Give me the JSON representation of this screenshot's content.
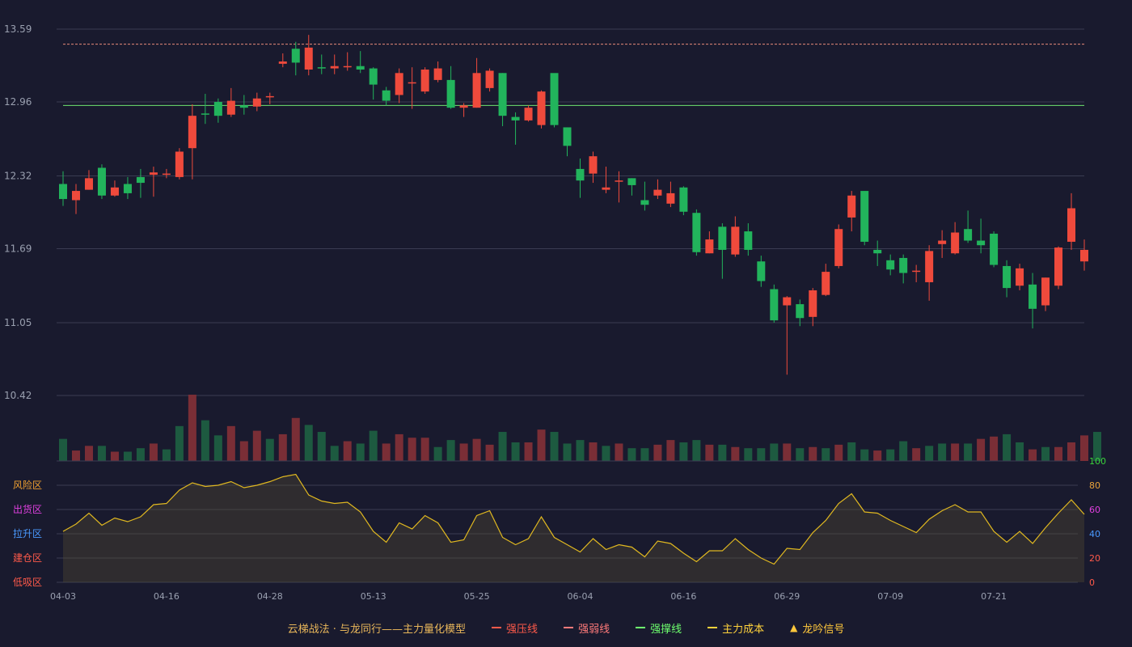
{
  "chart_data": {
    "type": "candlestick",
    "price_axis": {
      "ticks": [
        "13.59",
        "12.96",
        "12.32",
        "11.69",
        "11.05",
        "10.42"
      ],
      "min": 10.42,
      "max": 13.59
    },
    "x_tick_labels": [
      {
        "index": 0,
        "label": "04-03"
      },
      {
        "index": 8,
        "label": "04-16"
      },
      {
        "index": 16,
        "label": "04-28"
      },
      {
        "index": 24,
        "label": "05-13"
      },
      {
        "index": 32,
        "label": "05-25"
      },
      {
        "index": 40,
        "label": "06-04"
      },
      {
        "index": 48,
        "label": "06-16"
      },
      {
        "index": 56,
        "label": "06-29"
      },
      {
        "index": 64,
        "label": "07-09"
      },
      {
        "index": 72,
        "label": "07-21"
      }
    ],
    "candles": [
      [
        12.25,
        12.12,
        12.36,
        12.06
      ],
      [
        12.11,
        12.19,
        12.25,
        11.99
      ],
      [
        12.2,
        12.3,
        12.37,
        12.2
      ],
      [
        12.39,
        12.15,
        12.42,
        12.12
      ],
      [
        12.15,
        12.22,
        12.28,
        12.14
      ],
      [
        12.25,
        12.17,
        12.31,
        12.12
      ],
      [
        12.31,
        12.26,
        12.38,
        12.13
      ],
      [
        12.33,
        12.35,
        12.4,
        12.14
      ],
      [
        12.34,
        12.34,
        12.38,
        12.3
      ],
      [
        12.31,
        12.53,
        12.56,
        12.29
      ],
      [
        12.56,
        12.84,
        12.94,
        12.29
      ],
      [
        12.86,
        12.85,
        13.03,
        12.77
      ],
      [
        12.96,
        12.84,
        12.99,
        12.78
      ],
      [
        12.85,
        12.97,
        13.08,
        12.83
      ],
      [
        12.93,
        12.91,
        13.02,
        12.85
      ],
      [
        12.92,
        12.99,
        13.04,
        12.88
      ],
      [
        13.01,
        13.01,
        13.04,
        12.94
      ],
      [
        13.29,
        13.31,
        13.38,
        13.26
      ],
      [
        13.42,
        13.3,
        13.48,
        13.19
      ],
      [
        13.24,
        13.43,
        13.54,
        13.19
      ],
      [
        13.26,
        13.25,
        13.37,
        13.2
      ],
      [
        13.25,
        13.27,
        13.37,
        13.2
      ],
      [
        13.26,
        13.27,
        13.39,
        13.23
      ],
      [
        13.27,
        13.24,
        13.4,
        13.21
      ],
      [
        13.25,
        13.11,
        13.26,
        12.98
      ],
      [
        13.06,
        12.97,
        13.09,
        12.93
      ],
      [
        13.02,
        13.21,
        13.25,
        12.95
      ],
      [
        13.13,
        13.13,
        13.26,
        12.9
      ],
      [
        13.05,
        13.24,
        13.26,
        13.03
      ],
      [
        13.15,
        13.25,
        13.31,
        13.13
      ],
      [
        13.15,
        12.91,
        13.27,
        12.9
      ],
      [
        12.91,
        12.93,
        12.95,
        12.83
      ],
      [
        12.91,
        13.21,
        13.34,
        12.91
      ],
      [
        13.08,
        13.23,
        13.25,
        13.05
      ],
      [
        13.21,
        12.84,
        13.21,
        12.75
      ],
      [
        12.83,
        12.8,
        12.87,
        12.59
      ],
      [
        12.8,
        12.91,
        12.93,
        12.79
      ],
      [
        12.76,
        13.05,
        13.06,
        12.73
      ],
      [
        13.21,
        12.76,
        13.2,
        12.74
      ],
      [
        12.74,
        12.58,
        12.74,
        12.49
      ],
      [
        12.38,
        12.28,
        12.47,
        12.13
      ],
      [
        12.34,
        12.49,
        12.53,
        12.26
      ],
      [
        12.2,
        12.22,
        12.4,
        12.17
      ],
      [
        12.28,
        12.28,
        12.36,
        12.09
      ],
      [
        12.3,
        12.24,
        12.3,
        12.15
      ],
      [
        12.11,
        12.07,
        12.27,
        12.02
      ],
      [
        12.15,
        12.2,
        12.29,
        12.12
      ],
      [
        12.08,
        12.17,
        12.27,
        12.05
      ],
      [
        12.22,
        12.01,
        12.23,
        11.98
      ],
      [
        12.0,
        11.66,
        12.03,
        11.63
      ],
      [
        11.65,
        11.77,
        11.84,
        11.65
      ],
      [
        11.88,
        11.68,
        11.91,
        11.43
      ],
      [
        11.64,
        11.88,
        11.97,
        11.62
      ],
      [
        11.84,
        11.68,
        11.91,
        11.63
      ],
      [
        11.58,
        11.41,
        11.63,
        11.36
      ],
      [
        11.34,
        11.07,
        11.38,
        11.05
      ],
      [
        11.2,
        11.27,
        11.28,
        10.6
      ],
      [
        11.21,
        11.09,
        11.25,
        11.02
      ],
      [
        11.1,
        11.33,
        11.35,
        11.02
      ],
      [
        11.29,
        11.49,
        11.56,
        11.28
      ],
      [
        11.54,
        11.86,
        11.9,
        11.52
      ],
      [
        11.96,
        12.15,
        12.19,
        11.84
      ],
      [
        12.19,
        11.75,
        12.18,
        11.72
      ],
      [
        11.68,
        11.65,
        11.76,
        11.54
      ],
      [
        11.59,
        11.51,
        11.64,
        11.46
      ],
      [
        11.61,
        11.48,
        11.64,
        11.39
      ],
      [
        11.49,
        11.5,
        11.55,
        11.4
      ],
      [
        11.4,
        11.67,
        11.72,
        11.24
      ],
      [
        11.73,
        11.76,
        11.85,
        11.61
      ],
      [
        11.65,
        11.83,
        11.92,
        11.64
      ],
      [
        11.86,
        11.76,
        12.02,
        11.74
      ],
      [
        11.76,
        11.72,
        11.95,
        11.65
      ],
      [
        11.82,
        11.55,
        11.84,
        11.53
      ],
      [
        11.54,
        11.35,
        11.59,
        11.27
      ],
      [
        11.37,
        11.52,
        11.56,
        11.33
      ],
      [
        11.38,
        11.17,
        11.48,
        11.0
      ],
      [
        11.2,
        11.44,
        11.44,
        11.15
      ],
      [
        11.37,
        11.7,
        11.71,
        11.34
      ],
      [
        11.75,
        12.04,
        12.17,
        11.68
      ],
      [
        11.58,
        11.68,
        11.77,
        11.5
      ]
    ],
    "volume": [
      [
        1.9,
        "up"
      ],
      [
        0.9,
        "dn"
      ],
      [
        1.3,
        "dn"
      ],
      [
        1.3,
        "up"
      ],
      [
        0.8,
        "dn"
      ],
      [
        0.8,
        "up"
      ],
      [
        1.1,
        "up"
      ],
      [
        1.5,
        "dn"
      ],
      [
        1.0,
        "up"
      ],
      [
        3.0,
        "up"
      ],
      [
        5.7,
        "dn"
      ],
      [
        3.5,
        "up"
      ],
      [
        2.2,
        "up"
      ],
      [
        3.0,
        "dn"
      ],
      [
        1.7,
        "dn"
      ],
      [
        2.6,
        "dn"
      ],
      [
        1.9,
        "up"
      ],
      [
        2.3,
        "dn"
      ],
      [
        3.7,
        "dn"
      ],
      [
        3.1,
        "up"
      ],
      [
        2.5,
        "up"
      ],
      [
        1.3,
        "up"
      ],
      [
        1.7,
        "dn"
      ],
      [
        1.5,
        "up"
      ],
      [
        2.6,
        "up"
      ],
      [
        1.5,
        "dn"
      ],
      [
        2.3,
        "dn"
      ],
      [
        2.0,
        "dn"
      ],
      [
        2.0,
        "dn"
      ],
      [
        1.2,
        "up"
      ],
      [
        1.8,
        "up"
      ],
      [
        1.5,
        "dn"
      ],
      [
        1.9,
        "dn"
      ],
      [
        1.4,
        "dn"
      ],
      [
        2.5,
        "up"
      ],
      [
        1.6,
        "up"
      ],
      [
        1.6,
        "dn"
      ],
      [
        2.7,
        "dn"
      ],
      [
        2.5,
        "up"
      ],
      [
        1.5,
        "up"
      ],
      [
        1.8,
        "up"
      ],
      [
        1.6,
        "dn"
      ],
      [
        1.3,
        "up"
      ],
      [
        1.5,
        "dn"
      ],
      [
        1.1,
        "up"
      ],
      [
        1.1,
        "up"
      ],
      [
        1.4,
        "dn"
      ],
      [
        1.8,
        "dn"
      ],
      [
        1.6,
        "up"
      ],
      [
        1.8,
        "up"
      ],
      [
        1.4,
        "dn"
      ],
      [
        1.4,
        "up"
      ],
      [
        1.2,
        "dn"
      ],
      [
        1.1,
        "up"
      ],
      [
        1.1,
        "up"
      ],
      [
        1.5,
        "up"
      ],
      [
        1.5,
        "dn"
      ],
      [
        1.1,
        "up"
      ],
      [
        1.2,
        "dn"
      ],
      [
        1.1,
        "up"
      ],
      [
        1.4,
        "dn"
      ],
      [
        1.6,
        "up"
      ],
      [
        1.0,
        "up"
      ],
      [
        0.9,
        "dn"
      ],
      [
        1.0,
        "up"
      ],
      [
        1.7,
        "up"
      ],
      [
        1.1,
        "dn"
      ],
      [
        1.3,
        "up"
      ],
      [
        1.5,
        "up"
      ],
      [
        1.5,
        "dn"
      ],
      [
        1.5,
        "up"
      ],
      [
        1.9,
        "dn"
      ],
      [
        2.1,
        "dn"
      ],
      [
        2.3,
        "up"
      ],
      [
        1.6,
        "up"
      ],
      [
        1.0,
        "dn"
      ],
      [
        1.2,
        "up"
      ],
      [
        1.2,
        "dn"
      ],
      [
        1.6,
        "dn"
      ],
      [
        2.2,
        "dn"
      ],
      [
        2.5,
        "up"
      ]
    ],
    "horizontal_lines": [
      {
        "name": "强弱线",
        "value": 13.46,
        "style": "dashed",
        "color": "#e88a7a"
      },
      {
        "name": "强撑线",
        "value": 12.93,
        "style": "solid",
        "color": "#6ee36e"
      }
    ],
    "indicator": {
      "axis_ticks": [
        "100",
        "80",
        "60",
        "40",
        "20",
        "0"
      ],
      "zone_labels": [
        "风险区",
        "出货区",
        "拉升区",
        "建仓区",
        "低吸区"
      ],
      "values": [
        42,
        48,
        57,
        47,
        53,
        50,
        54,
        64,
        65,
        76,
        82,
        79,
        80,
        83,
        78,
        80,
        83,
        87,
        89,
        72,
        67,
        65,
        66,
        58,
        42,
        33,
        49,
        44,
        55,
        49,
        33,
        35,
        55,
        59,
        37,
        31,
        36,
        54,
        37,
        31,
        25,
        36,
        27,
        31,
        29,
        21,
        34,
        32,
        24,
        17,
        26,
        26,
        36,
        27,
        20,
        15,
        28,
        27,
        41,
        51,
        65,
        73,
        58,
        57,
        51,
        46,
        41,
        52,
        59,
        64,
        58,
        58,
        42,
        33,
        42,
        32,
        45,
        57,
        68,
        56
      ]
    }
  },
  "legend": {
    "title": "云梯战法 · 与龙同行——主力量化模型",
    "items": [
      {
        "label": "强压线",
        "style": "solid",
        "color": "#ff5a4a"
      },
      {
        "label": "强弱线",
        "style": "dashed",
        "color": "#ff7a7a"
      },
      {
        "label": "强撑线",
        "style": "solid",
        "color": "#6eff6e"
      },
      {
        "label": "主力成本",
        "style": "dashed",
        "color": "#ffd23c"
      },
      {
        "label": "龙吟信号",
        "style": "triangle",
        "color": "#ffc83c"
      }
    ]
  },
  "colors": {
    "up": "#ef4a3c",
    "down": "#22b45c",
    "vol_up": "#7a2e36",
    "vol_down": "#1d5a40",
    "indicator_line": "#e0b820",
    "grid": "#3a3c52",
    "axis_text": "#9aa0b0",
    "tick_100": "#3ad23a",
    "tick_80": "#e8a23a",
    "tick_60": "#e040e0",
    "tick_40": "#4a9aff",
    "tick_20": "#ff5a4a",
    "tick_0": "#ff5a4a",
    "zone_risk": "#f0a030",
    "zone_distribute": "#e040e0",
    "zone_rise": "#4a9aff",
    "zone_build": "#ff5a4a",
    "zone_buy": "#ff5a4a"
  }
}
